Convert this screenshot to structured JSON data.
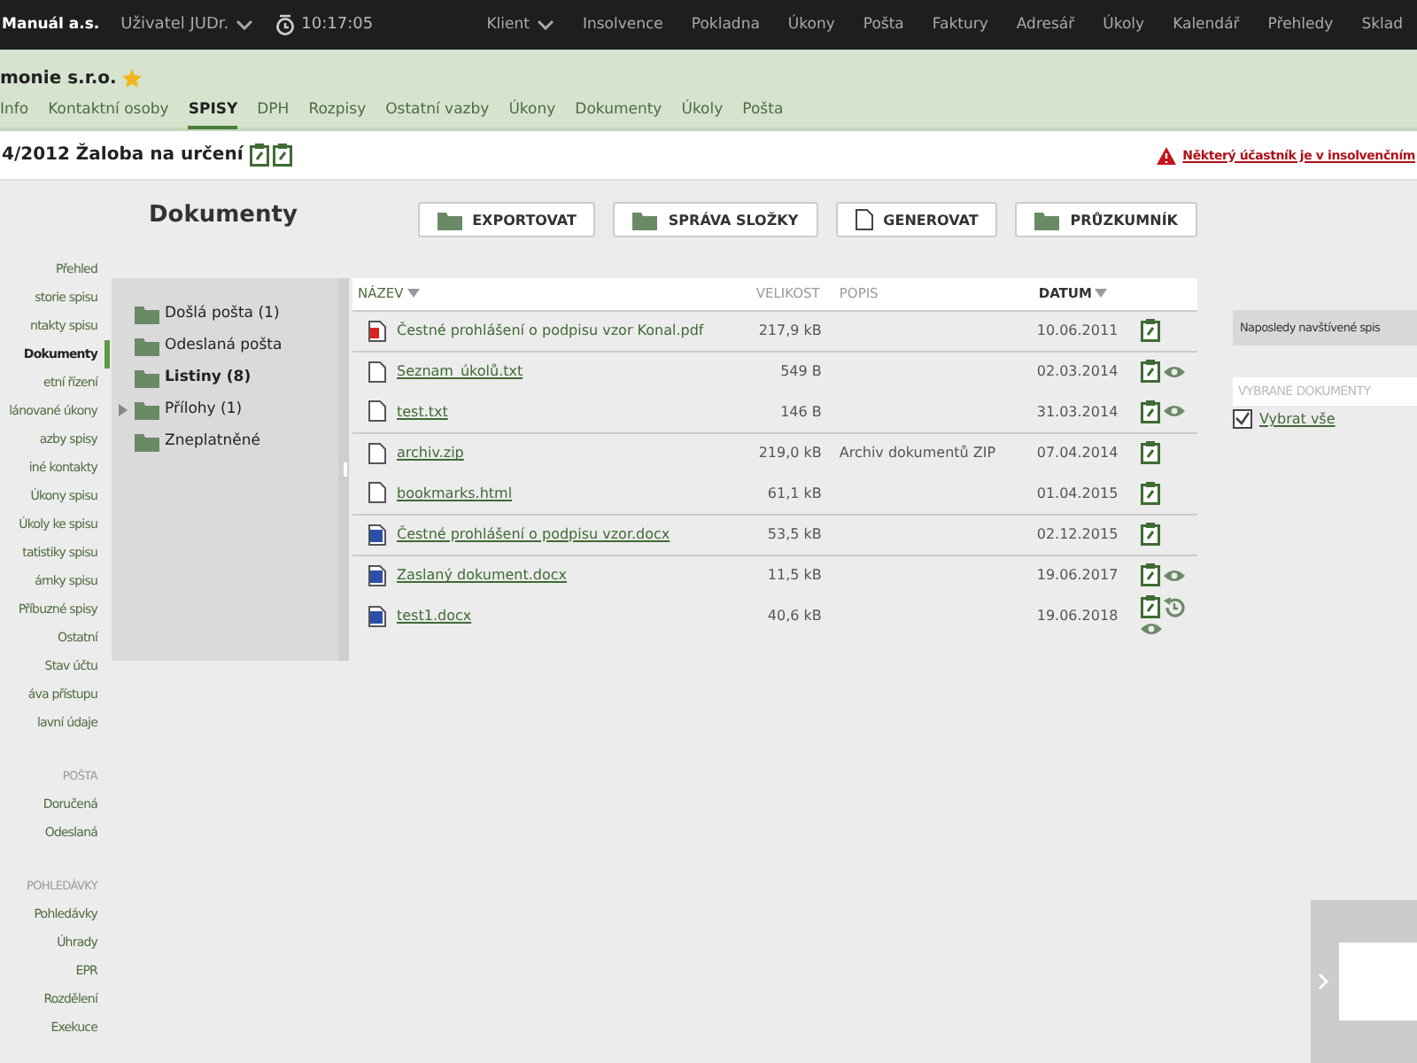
{
  "top_bar": {
    "company": "Manuál a.s.",
    "user": "Uživatel JUDr.",
    "clock": "10:17:05",
    "nav": [
      {
        "label": "Klient",
        "dropdown": true
      },
      {
        "label": "Insolvence",
        "dropdown": false
      },
      {
        "label": "Pokladna",
        "dropdown": false
      },
      {
        "label": "Úkony",
        "dropdown": false
      },
      {
        "label": "Pošta",
        "dropdown": false
      },
      {
        "label": "Faktury",
        "dropdown": false
      },
      {
        "label": "Adresář",
        "dropdown": false
      },
      {
        "label": "Úkoly",
        "dropdown": false
      },
      {
        "label": "Kalendář",
        "dropdown": false
      },
      {
        "label": "Přehledy",
        "dropdown": false
      },
      {
        "label": "Sklad",
        "dropdown": false
      }
    ]
  },
  "client": {
    "name": "monie s.r.o.",
    "favorite": true,
    "tabs": [
      {
        "label": "Info",
        "selected": false
      },
      {
        "label": "Kontaktní osoby",
        "selected": false
      },
      {
        "label": "SPISY",
        "selected": true
      },
      {
        "label": "DPH",
        "selected": false
      },
      {
        "label": "Rozpisy",
        "selected": false
      },
      {
        "label": "Ostatní vazby",
        "selected": false
      },
      {
        "label": "Úkony",
        "selected": false
      },
      {
        "label": "Dokumenty",
        "selected": false
      },
      {
        "label": "Úkoly",
        "selected": false
      },
      {
        "label": "Pošta",
        "selected": false
      }
    ]
  },
  "case": {
    "title": "4/2012 Žaloba na určení",
    "warning": "Některý účastník je v insolvenčním"
  },
  "sidebar": {
    "sections": [
      {
        "items": [
          {
            "label": "Přehled",
            "selected": false
          },
          {
            "label": "storie spisu",
            "selected": false
          },
          {
            "label": "ntakty spisu",
            "selected": false
          },
          {
            "label": "Dokumenty",
            "selected": true
          },
          {
            "label": "etní řízení",
            "selected": false
          },
          {
            "label": "lánované úkony",
            "selected": false
          },
          {
            "label": "azby spisy",
            "selected": false
          },
          {
            "label": "iné kontakty",
            "selected": false
          },
          {
            "label": "Úkony spisu",
            "selected": false
          },
          {
            "label": "Úkoly ke spisu",
            "selected": false
          },
          {
            "label": "tatistiky spisu",
            "selected": false
          },
          {
            "label": "ámky spisu",
            "selected": false
          },
          {
            "label": "Příbuzné spisy",
            "selected": false
          },
          {
            "label": "Ostatní",
            "selected": false
          },
          {
            "label": "Stav účtu",
            "selected": false
          },
          {
            "label": "áva přístupu",
            "selected": false
          },
          {
            "label": "lavní údaje",
            "selected": false
          }
        ]
      },
      {
        "heading": "POŠTA",
        "items": [
          {
            "label": "Doručená",
            "selected": false
          },
          {
            "label": "Odeslaná",
            "selected": false
          }
        ]
      },
      {
        "heading": "POHLEDÁVKY",
        "items": [
          {
            "label": "Pohledávky",
            "selected": false
          },
          {
            "label": "Úhrady",
            "selected": false
          },
          {
            "label": "EPR",
            "selected": false
          },
          {
            "label": "Rozdělení",
            "selected": false
          },
          {
            "label": "Exekuce",
            "selected": false
          }
        ]
      }
    ]
  },
  "heading": "Dokumenty",
  "toolbar": [
    {
      "label": "EXPORTOVAT",
      "kind": "folder"
    },
    {
      "label": "SPRÁVA SLOŽKY",
      "kind": "folder"
    },
    {
      "label": "GENEROVAT",
      "kind": "file"
    },
    {
      "label": "PRŮZKUMNÍK",
      "kind": "folder"
    }
  ],
  "folders": [
    {
      "label": "Došlá pošta (1)",
      "bold": false
    },
    {
      "label": "Odeslaná pošta",
      "bold": false
    },
    {
      "label": "Listiny (8)",
      "bold": true
    },
    {
      "label": "Přílohy (1)",
      "bold": false,
      "expanded": false
    },
    {
      "label": "Zneplatněné",
      "bold": false
    }
  ],
  "table": {
    "columns": [
      {
        "label": "NÁZEV",
        "sorted": true
      },
      {
        "label": "VELIKOST",
        "sorted": false
      },
      {
        "label": "POPIS",
        "sorted": false
      },
      {
        "label": "DATUM",
        "sorted": true
      }
    ],
    "row_groups": [
      [
        {
          "kind": "pdf",
          "name": "Čestné prohlášení o podpisu vzor Konal.pdf",
          "link": false,
          "size": "217,9 kB",
          "date": "10.06.2011",
          "actions": [
            {
              "kind": "clipboard"
            }
          ]
        }
      ],
      [
        {
          "kind": "text",
          "name": "Seznam_úkolů.txt",
          "link": true,
          "size": "549 B",
          "date": "02.03.2014",
          "actions": [
            {
              "kind": "clipboard"
            },
            {
              "kind": "eye"
            }
          ]
        },
        {
          "kind": "text",
          "name": "test.txt",
          "link": true,
          "size": "146 B",
          "date": "31.03.2014",
          "actions": [
            {
              "kind": "clipboard"
            },
            {
              "kind": "eye"
            }
          ]
        }
      ],
      [
        {
          "kind": "text",
          "name": "archiv.zip",
          "link": true,
          "size": "219,0 kB",
          "description": "Archiv dokumentů ZIP",
          "date": "07.04.2014",
          "actions": [
            {
              "kind": "clipboard"
            }
          ]
        },
        {
          "kind": "text",
          "name": "bookmarks.html",
          "link": true,
          "size": "61,1 kB",
          "date": "01.04.2015",
          "actions": [
            {
              "kind": "clipboard"
            }
          ]
        }
      ],
      [
        {
          "kind": "word",
          "name": "Čestné prohlášení o podpisu vzor.docx",
          "link": true,
          "size": "53,5 kB",
          "date": "02.12.2015",
          "actions": [
            {
              "kind": "clipboard"
            }
          ]
        }
      ],
      [
        {
          "kind": "word",
          "name": "Zaslaný dokument.docx",
          "link": true,
          "size": "11,5 kB",
          "date": "19.06.2017",
          "actions": [
            {
              "kind": "clipboard"
            },
            {
              "kind": "eye"
            }
          ]
        },
        {
          "kind": "word",
          "name": "test1.docx",
          "link": true,
          "size": "40,6 kB",
          "date": "19.06.2018",
          "actions": [
            {
              "kind": "clipboard"
            },
            {
              "kind": "history"
            },
            {
              "kind": "eye"
            }
          ]
        }
      ]
    ]
  },
  "right_panel": {
    "recent": "Naposledy navštívené spis",
    "selected_placeholder": "VYBRANÉ DOKUMENTY",
    "select_all": "Vybrat vše"
  }
}
